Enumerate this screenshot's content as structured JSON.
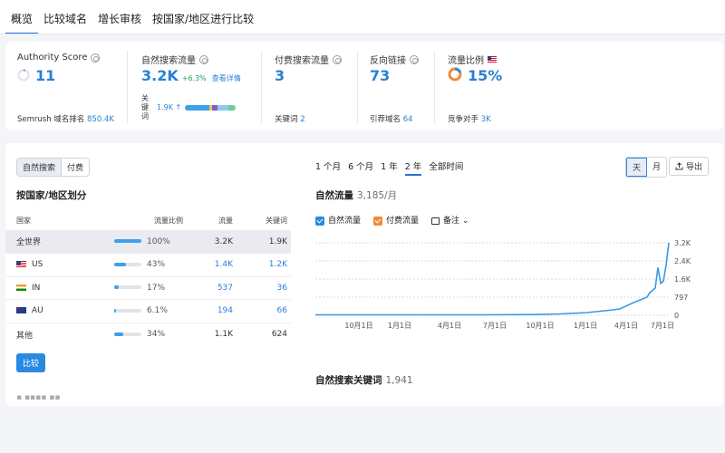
{
  "tabs": [
    {
      "label": "概览",
      "active": true
    },
    {
      "label": "比较域名",
      "active": false
    },
    {
      "label": "增长审核",
      "active": false
    },
    {
      "label": "按国家/地区进行比较",
      "active": false
    }
  ],
  "summary": {
    "authority": {
      "title": "Authority Score",
      "value": "11",
      "foot_label": "Semrush 域名排名",
      "foot_value": "850.4K"
    },
    "organic": {
      "title": "自然搜索流量",
      "value": "3.2K",
      "delta": "+6.3%",
      "detail": "查看详情",
      "kw_label": "关 键 词",
      "kw_value": "1.9K ↑"
    },
    "paid": {
      "title": "付费搜索流量",
      "value": "3",
      "foot_label": "关键词",
      "foot_value": "2"
    },
    "backlinks": {
      "title": "反向链接",
      "value": "73",
      "foot_label": "引荐域名",
      "foot_value": "64"
    },
    "share": {
      "title": "流量比例",
      "value": "15%",
      "foot_label": "竞争对手",
      "foot_value": "3K"
    }
  },
  "left": {
    "seg": [
      "自然搜索",
      "付费"
    ],
    "title": "按国家/地区划分",
    "headers": [
      "国家",
      "流量比例",
      "流量",
      "关键词"
    ],
    "rows": [
      {
        "country": "全世界",
        "flag": "",
        "share": "100%",
        "share_val": 100,
        "traffic": "3.2K",
        "keywords": "1.9K"
      },
      {
        "country": "US",
        "flag": "us",
        "share": "43%",
        "share_val": 43,
        "traffic": "1.4K",
        "keywords": "1.2K"
      },
      {
        "country": "IN",
        "flag": "in",
        "share": "17%",
        "share_val": 17,
        "traffic": "537",
        "keywords": "36"
      },
      {
        "country": "AU",
        "flag": "au",
        "share": "6.1%",
        "share_val": 6.1,
        "traffic": "194",
        "keywords": "66"
      },
      {
        "country": "其他",
        "flag": "",
        "share": "34%",
        "share_val": 34,
        "traffic": "1.1K",
        "keywords": "624"
      }
    ],
    "compare": "比较"
  },
  "right": {
    "periods": [
      {
        "label": "1 个月",
        "active": false
      },
      {
        "label": "6 个月",
        "active": false
      },
      {
        "label": "1 年",
        "active": false
      },
      {
        "label": "2 年",
        "active": true
      },
      {
        "label": "全部时间",
        "active": false
      }
    ],
    "granularity": [
      {
        "label": "天",
        "active": true
      },
      {
        "label": "月",
        "active": false
      }
    ],
    "export": "导出",
    "chart_title": "自然流量",
    "chart_sub": "3,185/月",
    "legend_organic": "自然流量",
    "legend_paid": "付费流量",
    "notes": "备注",
    "kw_title": "自然搜索关键词",
    "kw_sub": "1,941"
  },
  "chart_data": {
    "type": "line",
    "yticks": [
      "3.2K",
      "2.4K",
      "1.6K",
      "797",
      "0"
    ],
    "ylim": [
      0,
      3185
    ],
    "xticks": [
      "10月1日",
      "1月1日",
      "4月1日",
      "7月1日",
      "10月1日",
      "1月1日",
      "4月1日",
      "7月1日"
    ],
    "series": [
      {
        "name": "自然流量",
        "color": "#3a9ae6",
        "x": [
          0,
          20,
          40,
          60,
          80,
          90,
          100,
          108,
          112,
          116,
          118,
          120,
          122,
          123,
          124,
          125,
          126,
          127,
          128,
          129,
          130
        ],
        "values": [
          20,
          20,
          20,
          20,
          30,
          60,
          120,
          220,
          280,
          500,
          600,
          700,
          800,
          1000,
          1100,
          1200,
          2100,
          1400,
          1500,
          2200,
          3185
        ]
      }
    ]
  }
}
